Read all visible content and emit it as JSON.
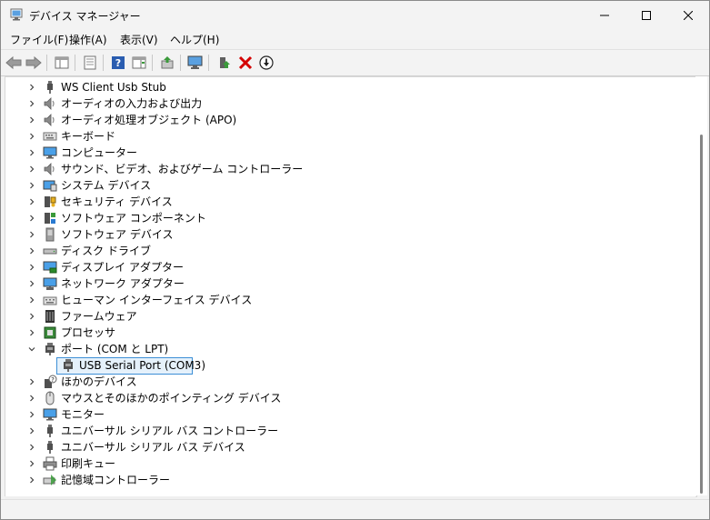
{
  "window": {
    "title": "デバイス マネージャー"
  },
  "menu": [
    {
      "label": "ファイル(F)"
    },
    {
      "label": "操作(A)"
    },
    {
      "label": "表示(V)"
    },
    {
      "label": "ヘルプ(H)"
    }
  ],
  "tree": [
    {
      "label": "WS Client Usb Stub",
      "icon": "usb-plug-icon",
      "expanded": false
    },
    {
      "label": "オーディオの入力および出力",
      "icon": "speaker-icon",
      "expanded": false
    },
    {
      "label": "オーディオ処理オブジェクト (APO)",
      "icon": "speaker-icon",
      "expanded": false
    },
    {
      "label": "キーボード",
      "icon": "keyboard-icon",
      "expanded": false
    },
    {
      "label": "コンピューター",
      "icon": "monitor-icon",
      "expanded": false
    },
    {
      "label": "サウンド、ビデオ、およびゲーム コントローラー",
      "icon": "speaker-icon",
      "expanded": false
    },
    {
      "label": "システム デバイス",
      "icon": "system-device-icon",
      "expanded": false
    },
    {
      "label": "セキュリティ デバイス",
      "icon": "security-device-icon",
      "expanded": false
    },
    {
      "label": "ソフトウェア コンポーネント",
      "icon": "software-component-icon",
      "expanded": false
    },
    {
      "label": "ソフトウェア デバイス",
      "icon": "software-device-icon",
      "expanded": false
    },
    {
      "label": "ディスク ドライブ",
      "icon": "disk-drive-icon",
      "expanded": false
    },
    {
      "label": "ディスプレイ アダプター",
      "icon": "display-adapter-icon",
      "expanded": false
    },
    {
      "label": "ネットワーク アダプター",
      "icon": "network-adapter-icon",
      "expanded": false
    },
    {
      "label": "ヒューマン インターフェイス デバイス",
      "icon": "hid-icon",
      "expanded": false
    },
    {
      "label": "ファームウェア",
      "icon": "firmware-icon",
      "expanded": false
    },
    {
      "label": "プロセッサ",
      "icon": "processor-icon",
      "expanded": false
    },
    {
      "label": "ポート (COM と LPT)",
      "icon": "port-icon",
      "expanded": true
    },
    {
      "label": "USB Serial Port (COM3)",
      "icon": "port-icon",
      "child": true,
      "selected": true
    },
    {
      "label": "ほかのデバイス",
      "icon": "unknown-device-icon",
      "expanded": false
    },
    {
      "label": "マウスとそのほかのポインティング デバイス",
      "icon": "mouse-icon",
      "expanded": false
    },
    {
      "label": "モニター",
      "icon": "monitor-icon",
      "expanded": false
    },
    {
      "label": "ユニバーサル シリアル バス コントローラー",
      "icon": "usb-plug-icon",
      "expanded": false
    },
    {
      "label": "ユニバーサル シリアル バス デバイス",
      "icon": "usb-plug-icon",
      "expanded": false
    },
    {
      "label": "印刷キュー",
      "icon": "printer-icon",
      "expanded": false
    },
    {
      "label": "記憶域コントローラー",
      "icon": "storage-controller-icon",
      "expanded": false
    }
  ],
  "colors": {
    "selection_bg": "#e5f1fb",
    "selection_border": "#3c8fd6",
    "delete_red": "#d40000"
  }
}
